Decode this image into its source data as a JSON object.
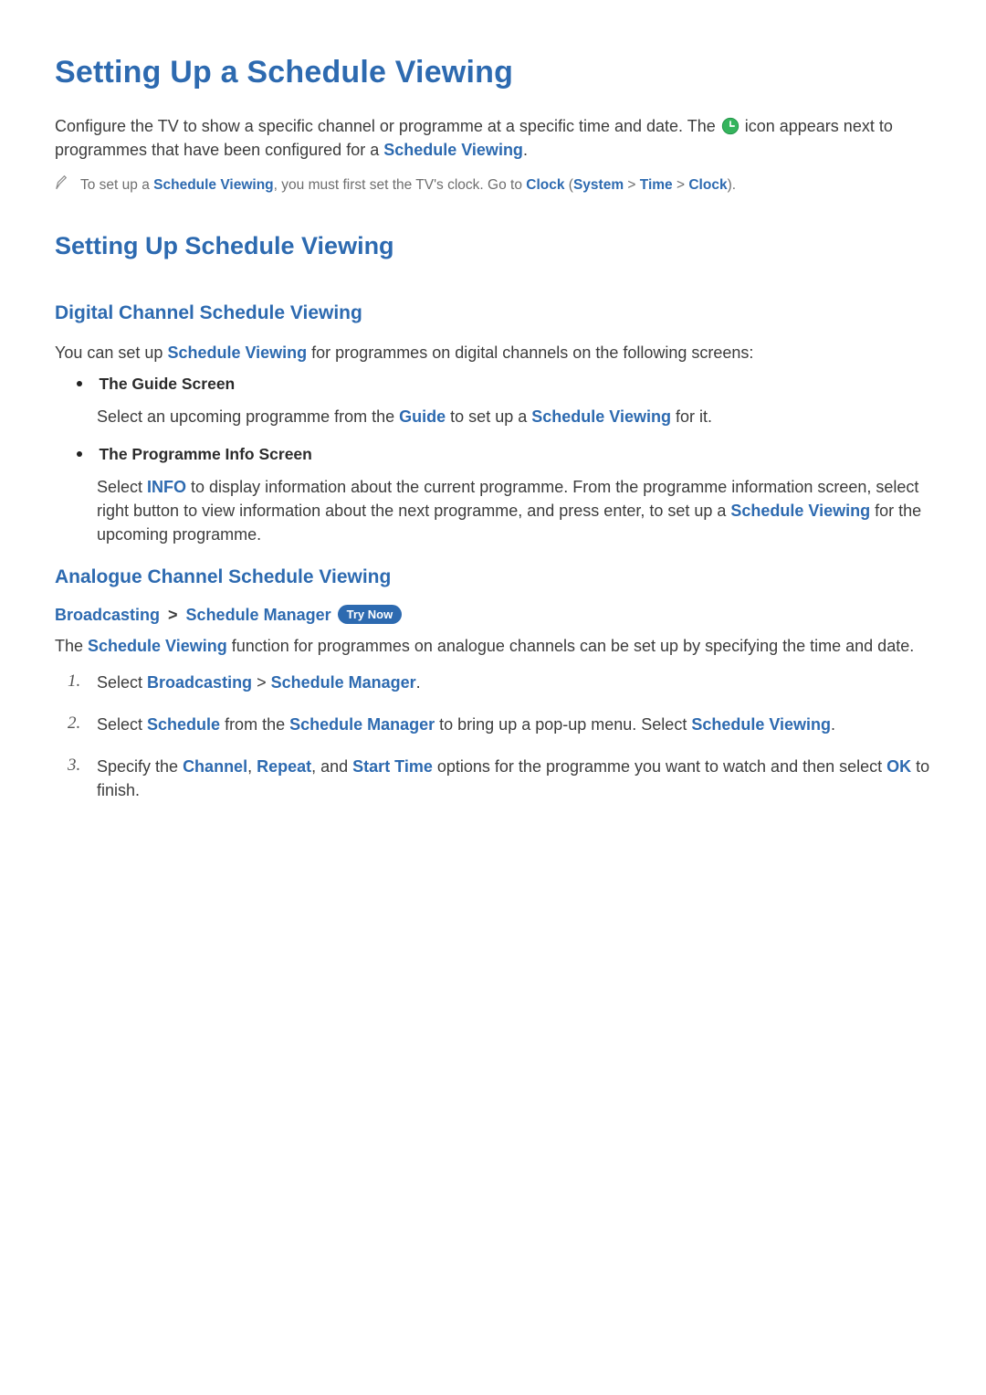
{
  "title": "Setting Up a Schedule Viewing",
  "intro": {
    "pre": "Configure the TV to show a specific channel or programme at a specific time and date. The ",
    "post_icon": " icon appears next to programmes that have been configured for a ",
    "schedule_viewing": "Schedule Viewing",
    "period": "."
  },
  "note": {
    "pre": "To set up a ",
    "schedule_viewing": "Schedule Viewing",
    "mid": ", you must first set the TV's clock. Go to ",
    "clock1": "Clock",
    "open": " (",
    "system": "System",
    "gt1": " > ",
    "time": "Time",
    "gt2": " > ",
    "clock2": "Clock",
    "close": ")."
  },
  "section2_title": "Setting Up Schedule Viewing",
  "digital": {
    "heading": "Digital Channel Schedule Viewing",
    "lead_pre": "You can set up ",
    "schedule_viewing": "Schedule Viewing",
    "lead_post": " for programmes on digital channels on the following screens:",
    "items": [
      {
        "label": "The Guide Screen",
        "body_pre": "Select an upcoming programme from the ",
        "guide": "Guide",
        "body_mid": " to set up a ",
        "schedule_viewing": "Schedule Viewing",
        "body_post": " for it."
      },
      {
        "label": "The Programme Info Screen",
        "body_pre": "Select ",
        "info": "INFO",
        "body_mid1": " to display information about the current programme. From the programme information screen, select right button to view information about the next programme, and press enter, to set up a ",
        "schedule_viewing": "Schedule Viewing",
        "body_post": " for the upcoming programme."
      }
    ]
  },
  "analogue": {
    "heading": "Analogue Channel Schedule Viewing",
    "crumb": {
      "broadcasting": "Broadcasting",
      "gt": " > ",
      "schedule_manager": "Schedule Manager",
      "try_now": "Try Now"
    },
    "lead_pre": "The ",
    "schedule_viewing": "Schedule Viewing",
    "lead_post": " function for programmes on analogue channels can be set up by specifying the time and date.",
    "steps": [
      {
        "pre": "Select ",
        "broadcasting": "Broadcasting",
        "gt": " > ",
        "schedule_manager": "Schedule Manager",
        "post": "."
      },
      {
        "pre": "Select ",
        "schedule": "Schedule",
        "mid1": " from the ",
        "schedule_manager": "Schedule Manager",
        "mid2": " to bring up a pop-up menu. Select ",
        "schedule_viewing": "Schedule Viewing",
        "post": "."
      },
      {
        "pre": "Specify the ",
        "channel": "Channel",
        "c1": ", ",
        "repeat": "Repeat",
        "c2": ", and ",
        "start_time": "Start Time",
        "mid": " options for the programme you want to watch and then select ",
        "ok": "OK",
        "post": " to finish."
      }
    ]
  }
}
